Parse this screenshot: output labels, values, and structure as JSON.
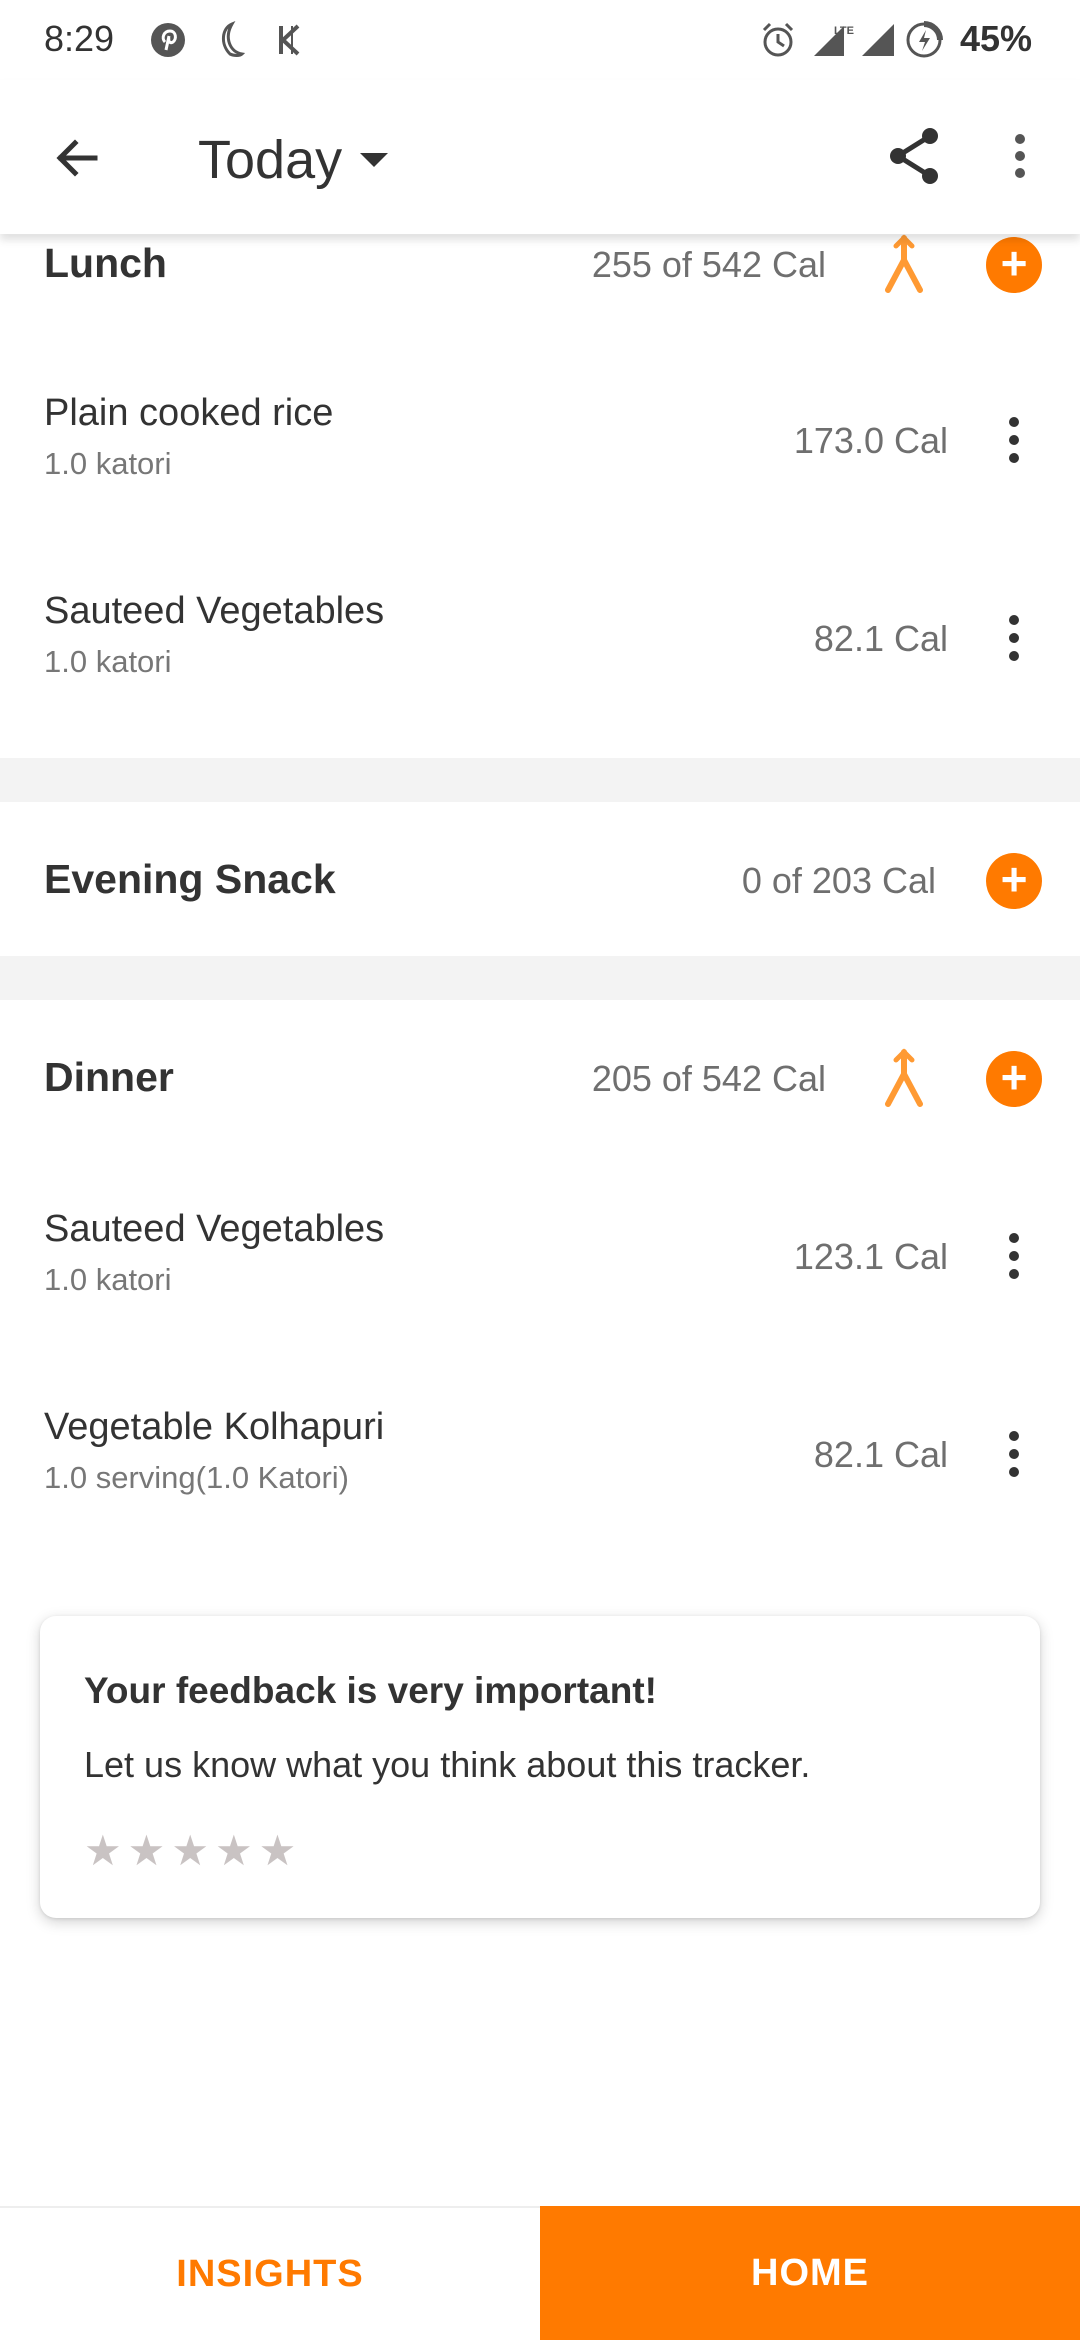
{
  "status_bar": {
    "time": "8:29",
    "battery": "45%",
    "icons": [
      "pinterest-icon",
      "moon-icon",
      "k-icon",
      "alarm-icon",
      "lte-signal-icon",
      "signal-icon",
      "battery-charging-icon"
    ]
  },
  "app_bar": {
    "title": "Today",
    "icons": [
      "back-arrow-icon",
      "dropdown-caret-icon",
      "share-icon",
      "more-vert-icon"
    ]
  },
  "meals": {
    "lunch": {
      "title": "Lunch",
      "calories": "255 of 542 Cal",
      "items": [
        {
          "name": "Plain cooked rice",
          "qty": "1.0 katori",
          "cal": "173.0 Cal"
        },
        {
          "name": "Sauteed Vegetables",
          "qty": "1.0 katori",
          "cal": "82.1 Cal"
        }
      ]
    },
    "evening_snack": {
      "title": "Evening Snack",
      "calories": "0 of 203 Cal"
    },
    "dinner": {
      "title": "Dinner",
      "calories": "205 of 542 Cal",
      "items": [
        {
          "name": "Sauteed Vegetables",
          "qty": "1.0 katori",
          "cal": "123.1 Cal"
        },
        {
          "name": "Vegetable Kolhapuri",
          "qty": "1.0 serving(1.0 Katori)",
          "cal": "82.1 Cal"
        }
      ]
    }
  },
  "feedback": {
    "title": "Your feedback is very important!",
    "text": "Let us know what you think about this tracker.",
    "rating": 0,
    "max_rating": 5
  },
  "bottom_nav": {
    "insights": "INSIGHTS",
    "home": "HOME"
  },
  "colors": {
    "accent": "#ff7a00",
    "divider": "#f3f3f3",
    "text": "#333333",
    "secondary_text": "#6f6f6f"
  }
}
